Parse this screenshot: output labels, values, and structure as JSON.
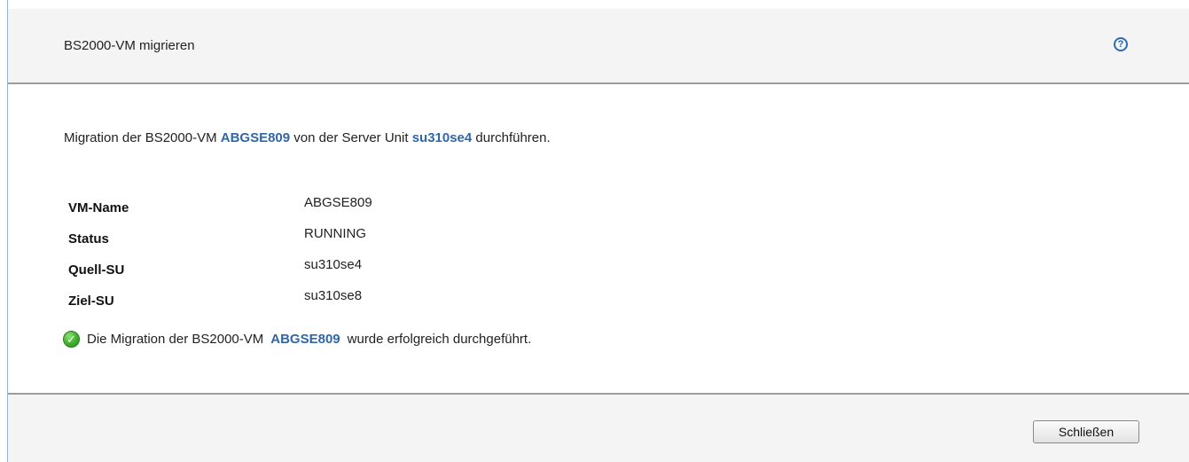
{
  "dialog": {
    "title": "BS2000-VM migrieren",
    "help_icon": "help-icon",
    "help_symbol": "?"
  },
  "intro": {
    "prefix": "Migration der BS2000-VM ",
    "vm_name": "ABGSE809",
    "middle": " von der Server Unit ",
    "server_unit": "su310se4",
    "suffix": " durchführen."
  },
  "properties": [
    {
      "label": "VM-Name",
      "value": "ABGSE809"
    },
    {
      "label": "Status",
      "value": "RUNNING"
    },
    {
      "label": "Quell-SU",
      "value": "su310se4"
    },
    {
      "label": "Ziel-SU",
      "value": "su310se8"
    }
  ],
  "result": {
    "icon": "success-check-icon",
    "icon_symbol": "✓",
    "prefix": "Die Migration der BS2000-VM",
    "vm_name": "ABGSE809",
    "suffix": "wurde erfolgreich durchgeführt."
  },
  "footer": {
    "close_label": "Schließen"
  },
  "colors": {
    "highlight": "#2f67a8",
    "header_bg": "#f4f4f4",
    "divider": "#9c9c9c",
    "success": "#3fae2c"
  }
}
